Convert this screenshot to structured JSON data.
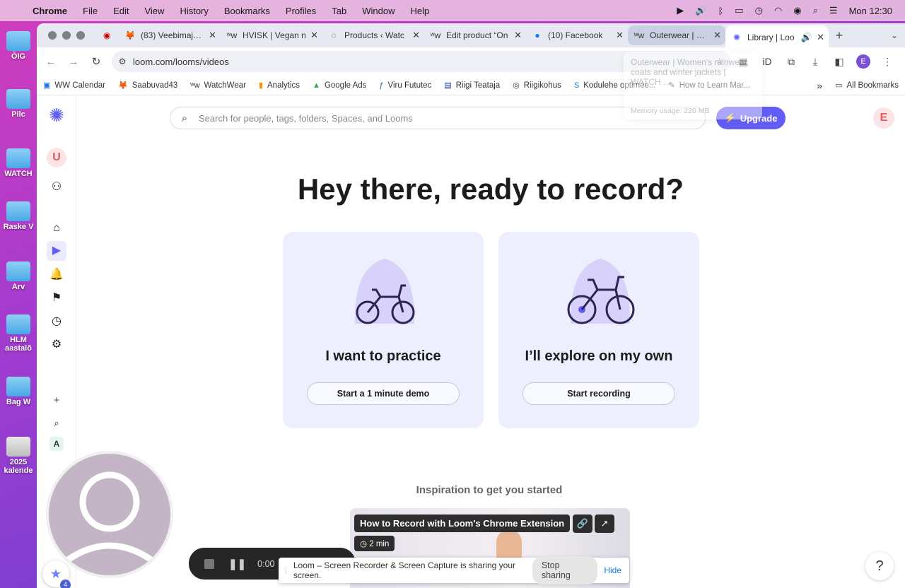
{
  "menubar": {
    "app": "Chrome",
    "items": [
      "File",
      "Edit",
      "View",
      "History",
      "Bookmarks",
      "Profiles",
      "Tab",
      "Window",
      "Help"
    ],
    "clock": "Mon  12:30"
  },
  "desktop": {
    "items": [
      "ÕIG",
      "Pilc",
      "WATCH",
      "Raske V",
      "Arv",
      "HLM aastalõ",
      "Bag W",
      "2025 kalende"
    ]
  },
  "tabs": [
    {
      "title": "(83) Veebimajutu",
      "icon": "fox-icon"
    },
    {
      "title": "HVISK | Vegan n",
      "icon": "ww-icon"
    },
    {
      "title": "Products ‹ Watc",
      "icon": "globe-icon"
    },
    {
      "title": "Edit product “On",
      "icon": "ww-icon"
    },
    {
      "title": "(10) Facebook",
      "icon": "facebook-icon"
    },
    {
      "title": "Outerwear | Won",
      "icon": "ww-icon"
    },
    {
      "title": "Library | Loo",
      "icon": "loom-icon"
    }
  ],
  "toolbar": {
    "url": "loom.com/looms/videos"
  },
  "tooltip": {
    "title": "Outerwear | Women's rainwear, coats and winter jackets | WATCH ...",
    "memory": "Memory usage: 220 MB"
  },
  "bookmarks": [
    {
      "label": "WW Calendar",
      "icon": "calendar-icon"
    },
    {
      "label": "Saabuvad43",
      "icon": "fox-icon"
    },
    {
      "label": "WatchWear",
      "icon": "ww-icon"
    },
    {
      "label": "Analytics",
      "icon": "analytics-icon"
    },
    {
      "label": "Google Ads",
      "icon": "google-ads-icon"
    },
    {
      "label": "Viru Fututec",
      "icon": "futu-icon"
    },
    {
      "label": "Riigi Teataja",
      "icon": "rt-icon"
    },
    {
      "label": "Riigikohus",
      "icon": "court-icon"
    },
    {
      "label": "Kodulehe optimee...",
      "icon": "s-icon"
    },
    {
      "label": "How to Learn Mar...",
      "icon": "pen-icon"
    }
  ],
  "all_bookmarks": "All Bookmarks",
  "loom": {
    "search_placeholder": "Search for people, tags, folders, Spaces, and Looms",
    "upgrade": "Upgrade",
    "user_initial": "E",
    "workspace_initial": "U",
    "rail_letter": "A",
    "headline": "Hey there, ready to record?",
    "cards": [
      {
        "title": "I want to practice",
        "button": "Start a 1 minute demo"
      },
      {
        "title": "I’ll explore on my own",
        "button": "Start recording"
      }
    ],
    "inspiration": "Inspiration to get you started",
    "video": {
      "title": "How to Record with Loom's Chrome Extension",
      "duration": "2 min"
    }
  },
  "recorder": {
    "time": "0:00",
    "badge_count": "4"
  },
  "share_bar": {
    "message": "Loom – Screen Recorder & Screen Capture is sharing your screen.",
    "stop": "Stop sharing",
    "hide": "Hide"
  },
  "help": "?"
}
